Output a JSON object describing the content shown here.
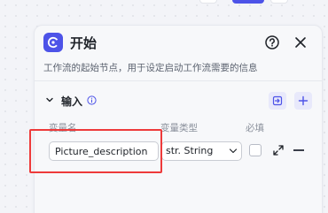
{
  "node": {
    "title": "开始",
    "description": "工作流的起始节点，用于设定启动工作流需要的信息",
    "icon": "start-node-icon",
    "accent_color": "#4d53e8"
  },
  "input_section": {
    "title": "输入",
    "columns": {
      "name": "变量名",
      "type": "变量类型",
      "required": "必填"
    },
    "rows": [
      {
        "name_value": "Picture_description",
        "type_value": "str. String",
        "required": false
      }
    ]
  },
  "highlight_color": "#ee3a3a"
}
